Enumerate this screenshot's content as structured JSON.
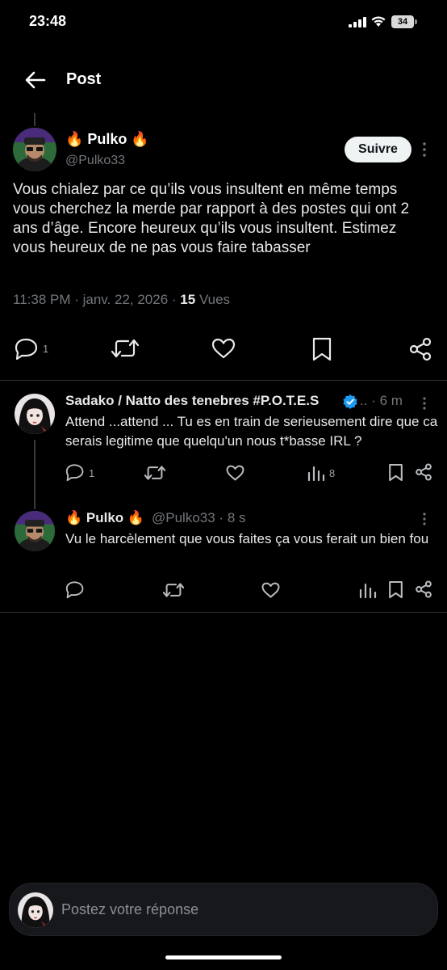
{
  "status_bar": {
    "time": "23:48",
    "battery": "34"
  },
  "header": {
    "title": "Post"
  },
  "post": {
    "author_name": "🔥 Pulko 🔥",
    "author_handle": "@Pulko33",
    "follow_label": "Suivre",
    "text": "Vous chialez par ce qu’ils vous insultent en même temps vous cherchez la merde par rapport à des postes qui ont 2 ans d’âge. Encore heureux qu’ils vous insultent. Estimez vous heureux de ne pas vous faire tabasser",
    "time": "11:38 PM",
    "date": "janv. 22, 2026",
    "views_count": "15",
    "views_label": "Vues",
    "replies_count": "1"
  },
  "replies": [
    {
      "author_name": "Sadako / Natto des tenebres #P.O.T.E.S",
      "ellipsis": "..",
      "time": "6 m",
      "text": "Attend ...attend ... Tu es en train de serieusement dire que ca serais legitime que quelqu'un nous t*basse IRL ?",
      "replies_count": "1",
      "views_count": "8"
    },
    {
      "author_name": "🔥 Pulko 🔥",
      "author_handle": "@Pulko33",
      "time": "8 s",
      "text": "Vu le harcèlement que vous faites ça vous ferait un bien fou"
    }
  ],
  "reply_bar": {
    "placeholder": "Postez votre réponse"
  },
  "colors": {
    "background": "#000000",
    "muted": "#71767b",
    "verified": "#1d9bf0",
    "divider": "#2f3336"
  }
}
